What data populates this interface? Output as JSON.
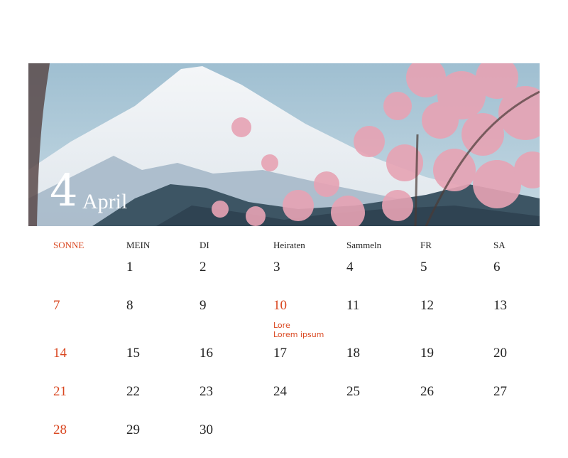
{
  "banner": {
    "month_number": "4",
    "month_name": "April",
    "image": "mount-fuji-cherry-blossom-photo"
  },
  "calendar": {
    "weekdays": [
      "SONNE",
      "MEIN",
      "DI",
      "Heiraten",
      "Sammeln",
      "FR",
      "SA"
    ],
    "weeks": [
      [
        "",
        "1",
        "2",
        "3",
        "4",
        "5",
        "6"
      ],
      [
        "7",
        "8",
        "9",
        "10",
        "11",
        "12",
        "13"
      ],
      [
        "14",
        "15",
        "16",
        "17",
        "18",
        "19",
        "20"
      ],
      [
        "21",
        "22",
        "23",
        "24",
        "25",
        "26",
        "27"
      ],
      [
        "28",
        "29",
        "30",
        "",
        "",
        "",
        ""
      ]
    ],
    "event": {
      "day": "10",
      "line1": "Lore",
      "line2": "Lorem ipsum"
    }
  },
  "colors": {
    "accent": "#d9461f",
    "text": "#222222",
    "background": "#ffffff"
  }
}
